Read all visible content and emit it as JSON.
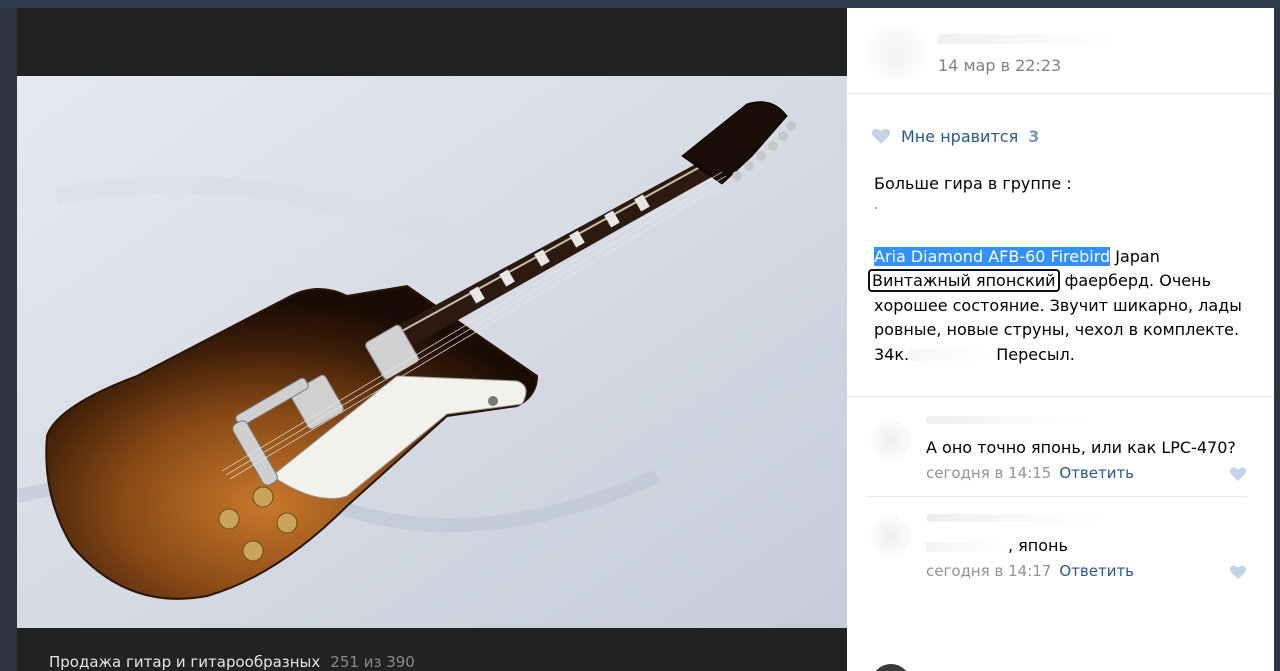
{
  "viewer": {
    "album_title": "Продажа гитар и гитарообразных",
    "photo_counter": "251 из 390"
  },
  "post": {
    "date": "14 мар в 22:23",
    "likes": {
      "label": "Мне нравится",
      "count": "3"
    },
    "text": {
      "line1": "Больше гира в группе :",
      "highlighted": "Aria Diamond AFB-60 Firebird",
      "after_highlight": " Japan",
      "boxed": "Винтажный японский",
      "after_boxed": " фаерберд. Очень",
      "line4": "хорошее состояние. Звучит шикарно, лады",
      "line5": "ровные, новые струны, чехол в комплекте.",
      "line6_start": "34к.",
      "line6_end": " Пересыл."
    }
  },
  "comments": [
    {
      "text": "А оно точно японь, или как LPC-470?",
      "time": "сегодня в 14:15",
      "reply_label": "Ответить"
    },
    {
      "text": ", японь",
      "time": "сегодня в 14:17",
      "reply_label": "Ответить"
    }
  ],
  "colors": {
    "link": "#2a5885",
    "highlight": "#3390ff",
    "meta": "#939393"
  }
}
